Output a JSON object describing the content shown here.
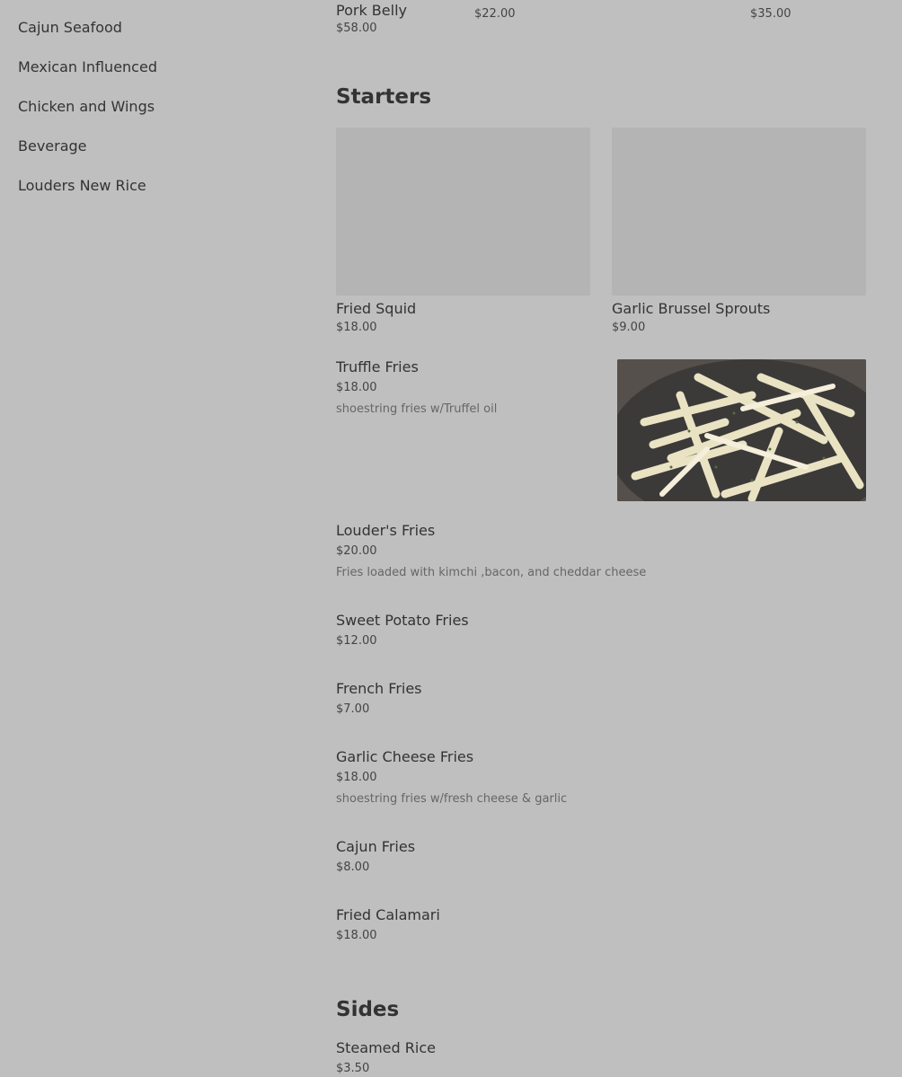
{
  "sidebar": {
    "items": [
      {
        "label": "Cajun Seafood"
      },
      {
        "label": "Mexican Influenced"
      },
      {
        "label": "Chicken and Wings"
      },
      {
        "label": "Beverage"
      },
      {
        "label": "Louders New Rice"
      }
    ]
  },
  "previous_section": {
    "items": [
      {
        "name_line1": "",
        "name_line2": "Pork Belly",
        "price": "$58.00"
      },
      {
        "name_line1": "",
        "price": "$22.00"
      },
      {
        "name_line1": "",
        "price": ""
      },
      {
        "name_line1": "",
        "price": "$35.00"
      }
    ]
  },
  "starters": {
    "title": "Starters",
    "cards": [
      {
        "name": "Fried Squid",
        "price": "$18.00"
      },
      {
        "name": "Garlic Brussel Sprouts",
        "price": "$9.00"
      }
    ],
    "items": [
      {
        "name": "Truffle Fries",
        "price": "$18.00",
        "description": "shoestring fries w/Truffel oil"
      },
      {
        "name": "Louder's Fries",
        "price": "$20.00",
        "description": "Fries loaded with kimchi ,bacon, and cheddar cheese"
      },
      {
        "name": "Sweet Potato Fries",
        "price": "$12.00",
        "description": ""
      },
      {
        "name": "French Fries",
        "price": "$7.00",
        "description": ""
      },
      {
        "name": "Garlic Cheese Fries",
        "price": "$18.00",
        "description": "shoestring fries w/fresh cheese & garlic"
      },
      {
        "name": "Cajun Fries",
        "price": "$8.00",
        "description": ""
      },
      {
        "name": "Fried Calamari",
        "price": "$18.00",
        "description": ""
      }
    ]
  },
  "sides": {
    "title": "Sides",
    "items": [
      {
        "name": "Steamed Rice",
        "price": "$3.50"
      }
    ]
  },
  "colors": {
    "background": "#bfbfbf",
    "placeholder_image": "#b4b4b4",
    "text": "#333333"
  }
}
